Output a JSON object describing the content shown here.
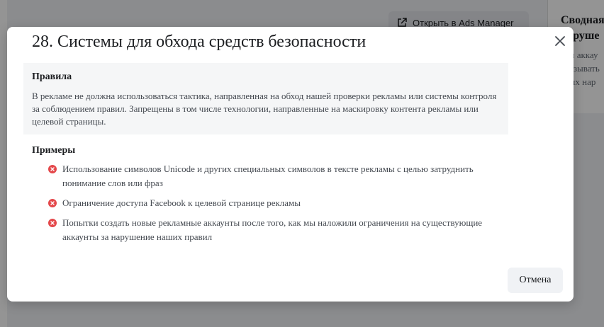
{
  "background": {
    "ads_button_label": "Открыть в Ads Manager",
    "right_panel_title_line1": "Сводная",
    "right_panel_title_line2": "наруше",
    "right_panel_text_line1": "ли аккау",
    "right_panel_text_line2": "казывать",
    "right_panel_text_line3": "тых нар"
  },
  "modal": {
    "title": "28. Системы для обхода средств безопасности",
    "rules": {
      "heading": "Правила",
      "text": "В рекламе не должна использоваться тактика, направленная на обход нашей проверки рекламы или системы контроля за соблюдением правил. Запрещены в том числе технологии, направленные на маскировку контента рекламы или целевой страницы."
    },
    "examples": {
      "heading": "Примеры",
      "items": [
        {
          "icon": "x-circle-icon",
          "text": "Использование символов Unicode и других специальных символов в тексте рекламы с целью затруднить понимание слов или фраз"
        },
        {
          "icon": "x-circle-icon",
          "text": "Ограничение доступа Facebook к целевой странице рекламы"
        },
        {
          "icon": "x-circle-icon",
          "text": "Попытки создать новые рекламные аккаунты после того, как мы наложили ограничения на существующие аккаунты за нарушение наших правил"
        }
      ]
    },
    "cancel_label": "Отмена"
  },
  "colors": {
    "error_red": "#e4484b",
    "overlay": "rgba(0,0,0,0.42)"
  }
}
